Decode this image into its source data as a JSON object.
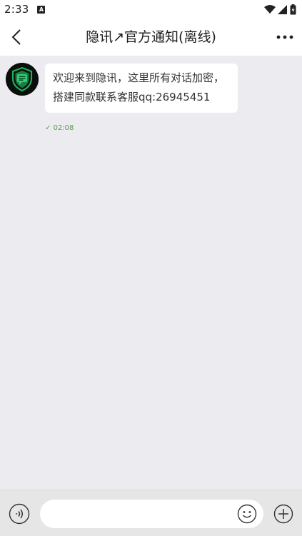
{
  "status_bar": {
    "time": "2:33",
    "notification_icon_letter": "A",
    "icons": [
      "wifi-icon",
      "signal-icon",
      "battery-icon"
    ]
  },
  "header": {
    "title": "隐讯↗官方通知(离线)",
    "back_icon": "chevron-left-icon",
    "more_icon": "more-horizontal-icon"
  },
  "messages": [
    {
      "sender_avatar": "shield-chat-logo",
      "lines": [
        "欢迎来到隐讯，这里所有对话加密，",
        "搭建同款联系客服qq:26945451"
      ],
      "status_mark": "✓",
      "time": "02:08"
    }
  ],
  "input_bar": {
    "placeholder": "",
    "value": "",
    "voice_icon": "voice-icon",
    "emoji_icon": "emoji-icon",
    "plus_icon": "plus-circle-icon"
  },
  "colors": {
    "chat_background": "#ebebf0",
    "bar_background": "#ffffff",
    "input_bar_background": "#e6e6e6",
    "meta_green": "#5a9a4a",
    "avatar_shield": "#1fae5a"
  }
}
